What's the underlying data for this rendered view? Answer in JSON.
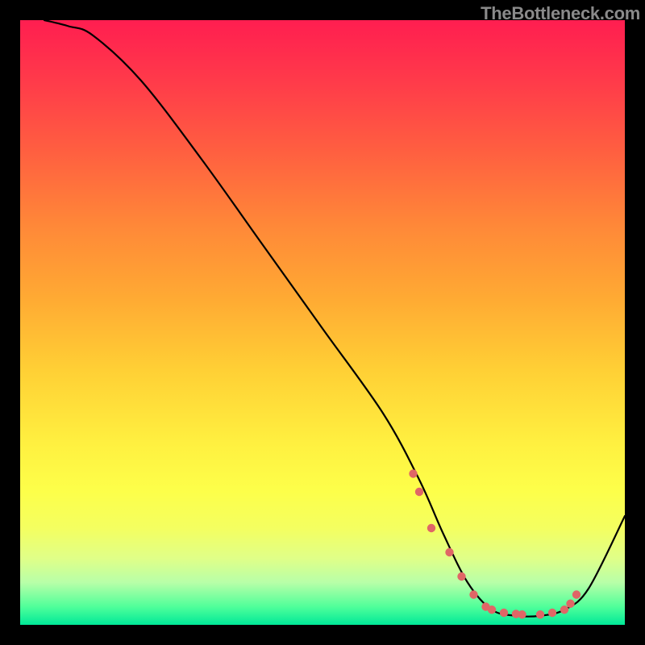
{
  "watermark": "TheBottleneck.com",
  "chart_data": {
    "type": "line",
    "title": "",
    "xlabel": "",
    "ylabel": "",
    "xlim": [
      0,
      100
    ],
    "ylim": [
      0,
      100
    ],
    "series": [
      {
        "name": "bottleneck-curve",
        "x": [
          4,
          8,
          12,
          20,
          30,
          40,
          50,
          60,
          66,
          70,
          74,
          78,
          82,
          86,
          90,
          94,
          100
        ],
        "y": [
          100,
          99,
          97.5,
          90,
          77,
          63,
          49,
          35,
          24,
          15,
          7,
          2.5,
          1.5,
          1.5,
          2.5,
          6,
          18
        ]
      }
    ],
    "markers": {
      "name": "highlight-dots",
      "color_hex": "#e06666",
      "x": [
        65,
        66,
        68,
        71,
        73,
        75,
        77,
        78,
        80,
        82,
        83,
        86,
        88,
        90,
        91,
        92
      ],
      "y": [
        25,
        22,
        16,
        12,
        8,
        5,
        3,
        2.5,
        2,
        1.8,
        1.7,
        1.7,
        2,
        2.5,
        3.5,
        5
      ]
    }
  }
}
